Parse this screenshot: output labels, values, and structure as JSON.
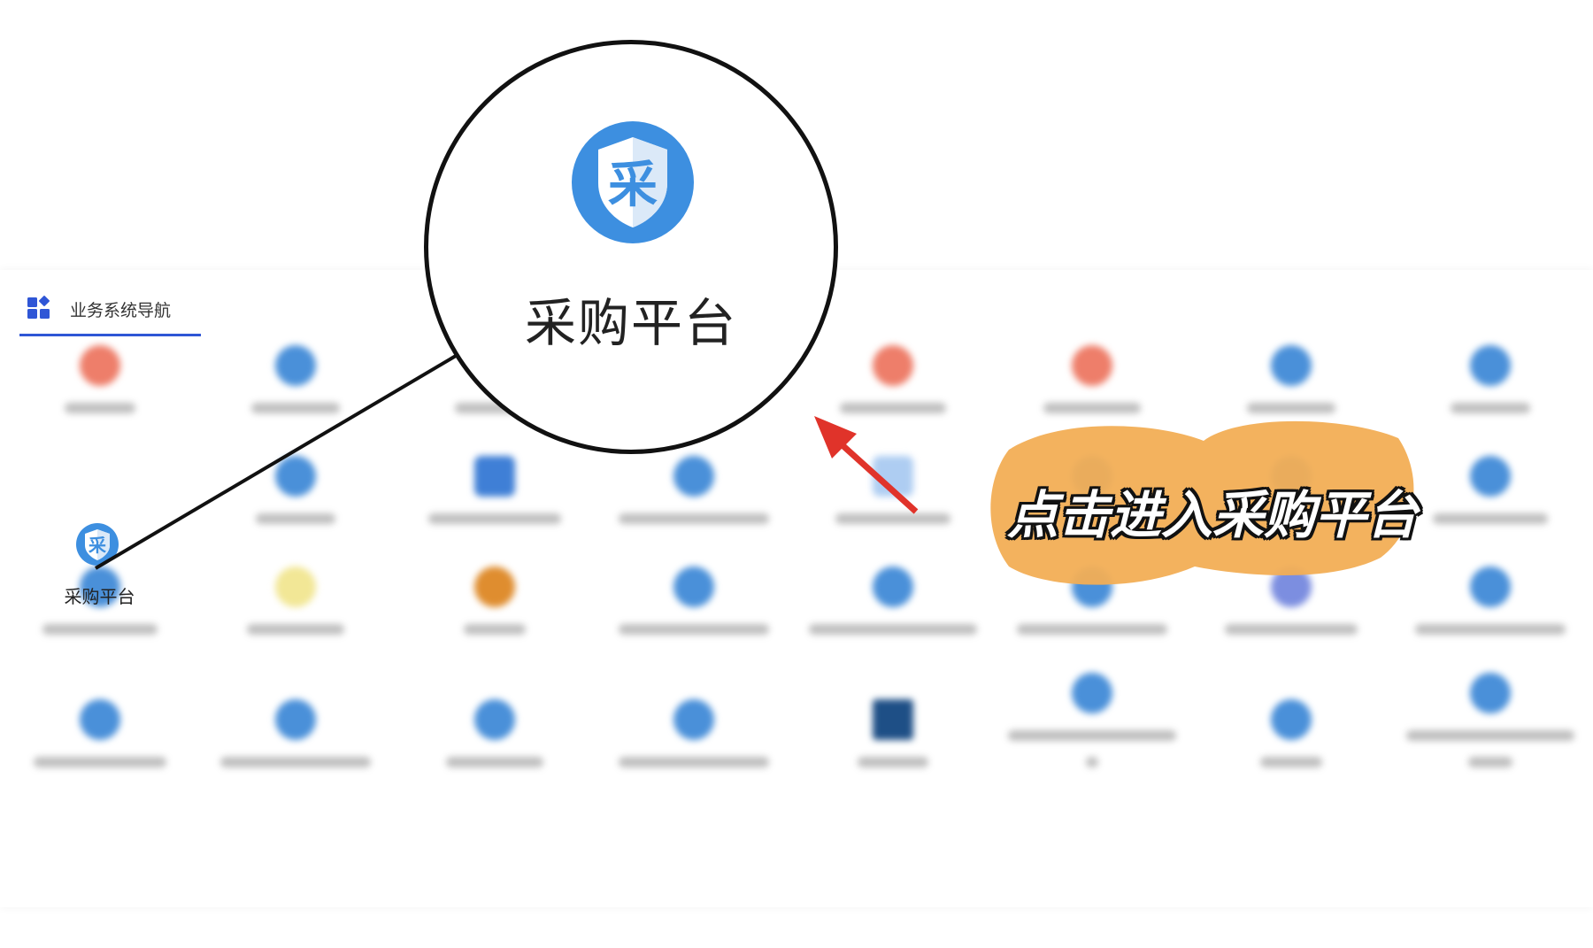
{
  "nav": {
    "title": "业务系统导航"
  },
  "featured_app": {
    "label": "采购平台",
    "icon": "shield-cai-icon",
    "glyph": "采",
    "color": "#3d8fe0"
  },
  "zoom": {
    "label": "采购平台"
  },
  "callout": {
    "text": "点击进入采购平台",
    "highlight_color": "#f2ae55",
    "arrow_color": "#e0332a"
  },
  "colors": {
    "accent": "#2f56d6",
    "app_blue": "#4a90d9",
    "app_red": "#ee7e6a",
    "app_yellow": "#f2e796",
    "app_orange": "#df8d2f",
    "app_purple": "#7c8ee0",
    "app_navy": "#1e4f86"
  }
}
